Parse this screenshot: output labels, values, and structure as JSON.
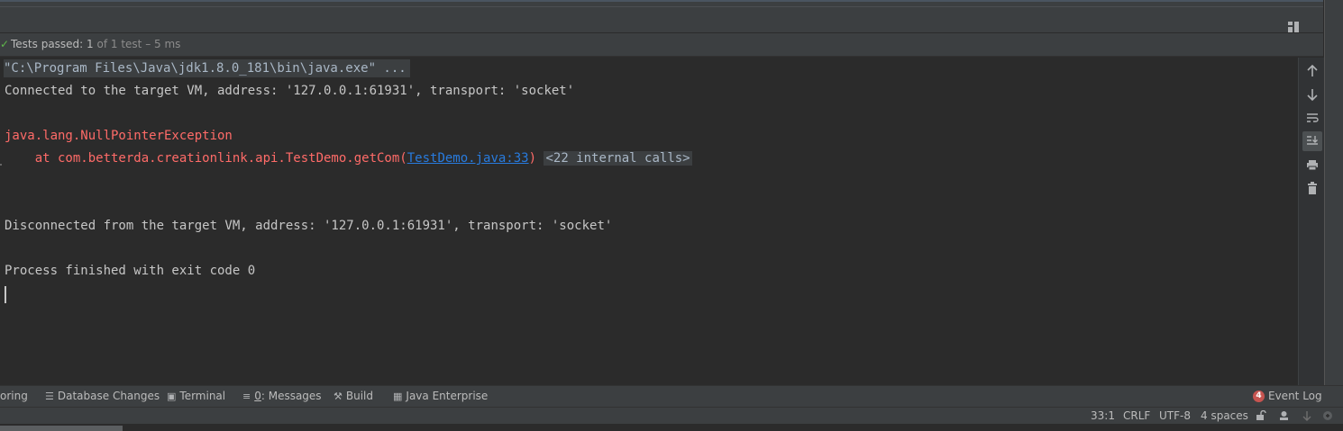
{
  "test_status": {
    "check_icon": "✓",
    "label": "Tests passed:",
    "count": "1",
    "detail": "of 1 test – 5 ms"
  },
  "console": {
    "command": "\"C:\\Program Files\\Java\\jdk1.8.0_181\\bin\\java.exe\" ...",
    "connected": "Connected to the target VM, address: '127.0.0.1:61931', transport: 'socket'",
    "exception": "java.lang.NullPointerException",
    "stack_prefix": "    at com.betterda.creationlink.api.TestDemo.getCom(",
    "stack_link": "TestDemo.java:33",
    "stack_suffix": ")",
    "internal_calls": "<22 internal calls>",
    "disconnected": "Disconnected from the target VM, address: '127.0.0.1:61931', transport: 'socket'",
    "finished": "Process finished with exit code 0"
  },
  "console_tools": [
    {
      "name": "up-arrow-icon",
      "glyph": "↑"
    },
    {
      "name": "down-arrow-icon",
      "glyph": "↓"
    },
    {
      "name": "soft-wrap-icon",
      "glyph": "⤶"
    },
    {
      "name": "scroll-to-end-icon",
      "glyph": "⇊"
    },
    {
      "name": "print-icon",
      "glyph": "⎙"
    },
    {
      "name": "trash-icon",
      "glyph": "🗑"
    }
  ],
  "bottom_tabs": {
    "profiling_fragment": "oring",
    "database_changes": "Database Changes",
    "terminal": "Terminal",
    "messages_mnemonic": "0",
    "messages": ": Messages",
    "build": "Build",
    "java_enterprise": "Java Enterprise",
    "event_log_badge": "4",
    "event_log": "Event Log"
  },
  "statusbar": {
    "position": "33:1",
    "line_separator": "CRLF",
    "encoding": "UTF-8",
    "indent": "4 spaces"
  },
  "colors": {
    "background": "#2b2b2b",
    "panel": "#3c3f41",
    "error": "#ff6b68",
    "link": "#287bde",
    "success": "#5fb84b"
  }
}
